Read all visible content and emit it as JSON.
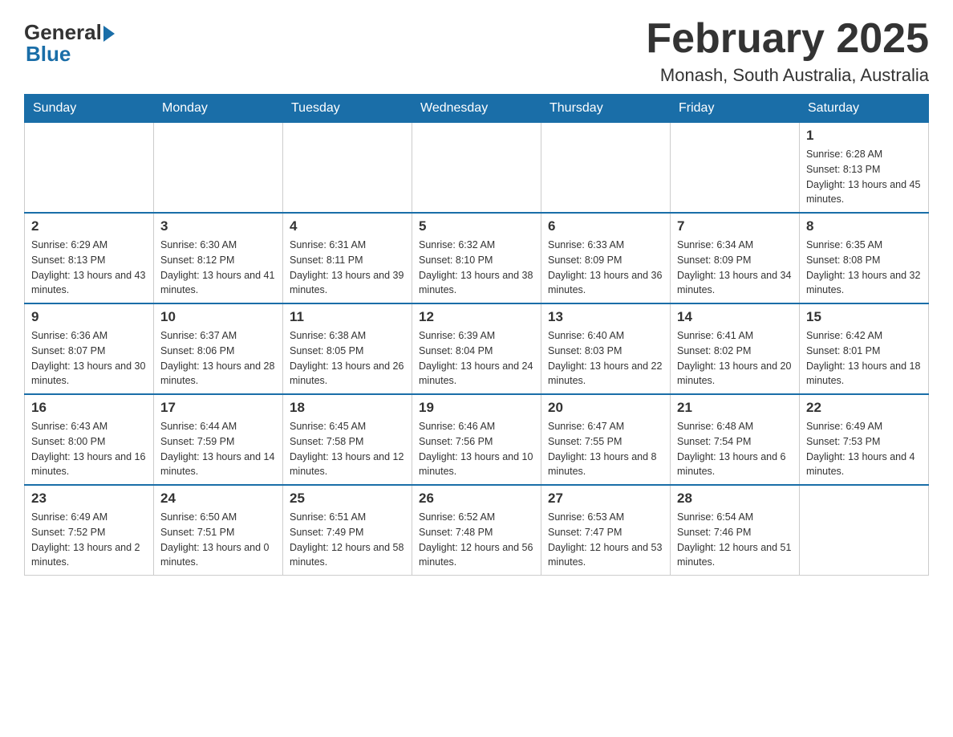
{
  "header": {
    "logo_general": "General",
    "logo_blue": "Blue",
    "month_title": "February 2025",
    "location": "Monash, South Australia, Australia"
  },
  "weekdays": [
    "Sunday",
    "Monday",
    "Tuesday",
    "Wednesday",
    "Thursday",
    "Friday",
    "Saturday"
  ],
  "weeks": [
    [
      {
        "day": "",
        "info": ""
      },
      {
        "day": "",
        "info": ""
      },
      {
        "day": "",
        "info": ""
      },
      {
        "day": "",
        "info": ""
      },
      {
        "day": "",
        "info": ""
      },
      {
        "day": "",
        "info": ""
      },
      {
        "day": "1",
        "info": "Sunrise: 6:28 AM\nSunset: 8:13 PM\nDaylight: 13 hours and 45 minutes."
      }
    ],
    [
      {
        "day": "2",
        "info": "Sunrise: 6:29 AM\nSunset: 8:13 PM\nDaylight: 13 hours and 43 minutes."
      },
      {
        "day": "3",
        "info": "Sunrise: 6:30 AM\nSunset: 8:12 PM\nDaylight: 13 hours and 41 minutes."
      },
      {
        "day": "4",
        "info": "Sunrise: 6:31 AM\nSunset: 8:11 PM\nDaylight: 13 hours and 39 minutes."
      },
      {
        "day": "5",
        "info": "Sunrise: 6:32 AM\nSunset: 8:10 PM\nDaylight: 13 hours and 38 minutes."
      },
      {
        "day": "6",
        "info": "Sunrise: 6:33 AM\nSunset: 8:09 PM\nDaylight: 13 hours and 36 minutes."
      },
      {
        "day": "7",
        "info": "Sunrise: 6:34 AM\nSunset: 8:09 PM\nDaylight: 13 hours and 34 minutes."
      },
      {
        "day": "8",
        "info": "Sunrise: 6:35 AM\nSunset: 8:08 PM\nDaylight: 13 hours and 32 minutes."
      }
    ],
    [
      {
        "day": "9",
        "info": "Sunrise: 6:36 AM\nSunset: 8:07 PM\nDaylight: 13 hours and 30 minutes."
      },
      {
        "day": "10",
        "info": "Sunrise: 6:37 AM\nSunset: 8:06 PM\nDaylight: 13 hours and 28 minutes."
      },
      {
        "day": "11",
        "info": "Sunrise: 6:38 AM\nSunset: 8:05 PM\nDaylight: 13 hours and 26 minutes."
      },
      {
        "day": "12",
        "info": "Sunrise: 6:39 AM\nSunset: 8:04 PM\nDaylight: 13 hours and 24 minutes."
      },
      {
        "day": "13",
        "info": "Sunrise: 6:40 AM\nSunset: 8:03 PM\nDaylight: 13 hours and 22 minutes."
      },
      {
        "day": "14",
        "info": "Sunrise: 6:41 AM\nSunset: 8:02 PM\nDaylight: 13 hours and 20 minutes."
      },
      {
        "day": "15",
        "info": "Sunrise: 6:42 AM\nSunset: 8:01 PM\nDaylight: 13 hours and 18 minutes."
      }
    ],
    [
      {
        "day": "16",
        "info": "Sunrise: 6:43 AM\nSunset: 8:00 PM\nDaylight: 13 hours and 16 minutes."
      },
      {
        "day": "17",
        "info": "Sunrise: 6:44 AM\nSunset: 7:59 PM\nDaylight: 13 hours and 14 minutes."
      },
      {
        "day": "18",
        "info": "Sunrise: 6:45 AM\nSunset: 7:58 PM\nDaylight: 13 hours and 12 minutes."
      },
      {
        "day": "19",
        "info": "Sunrise: 6:46 AM\nSunset: 7:56 PM\nDaylight: 13 hours and 10 minutes."
      },
      {
        "day": "20",
        "info": "Sunrise: 6:47 AM\nSunset: 7:55 PM\nDaylight: 13 hours and 8 minutes."
      },
      {
        "day": "21",
        "info": "Sunrise: 6:48 AM\nSunset: 7:54 PM\nDaylight: 13 hours and 6 minutes."
      },
      {
        "day": "22",
        "info": "Sunrise: 6:49 AM\nSunset: 7:53 PM\nDaylight: 13 hours and 4 minutes."
      }
    ],
    [
      {
        "day": "23",
        "info": "Sunrise: 6:49 AM\nSunset: 7:52 PM\nDaylight: 13 hours and 2 minutes."
      },
      {
        "day": "24",
        "info": "Sunrise: 6:50 AM\nSunset: 7:51 PM\nDaylight: 13 hours and 0 minutes."
      },
      {
        "day": "25",
        "info": "Sunrise: 6:51 AM\nSunset: 7:49 PM\nDaylight: 12 hours and 58 minutes."
      },
      {
        "day": "26",
        "info": "Sunrise: 6:52 AM\nSunset: 7:48 PM\nDaylight: 12 hours and 56 minutes."
      },
      {
        "day": "27",
        "info": "Sunrise: 6:53 AM\nSunset: 7:47 PM\nDaylight: 12 hours and 53 minutes."
      },
      {
        "day": "28",
        "info": "Sunrise: 6:54 AM\nSunset: 7:46 PM\nDaylight: 12 hours and 51 minutes."
      },
      {
        "day": "",
        "info": ""
      }
    ]
  ]
}
